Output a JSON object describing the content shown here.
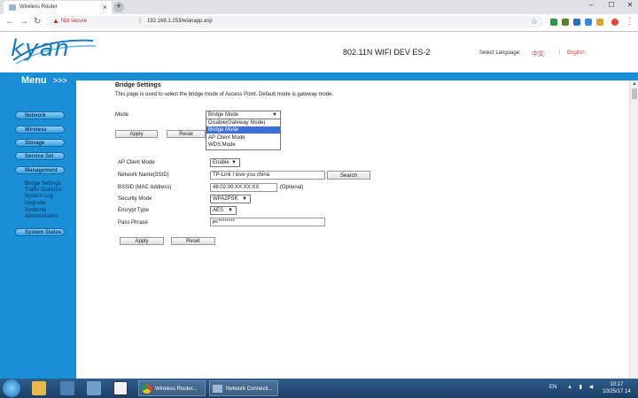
{
  "browser": {
    "tab_title": "Wireless Router",
    "tab_close": "×",
    "new_tab": "+",
    "not_secure": "Not secure",
    "url": "192.168.1.253/wlanapp.asp",
    "window_min": "–",
    "window_max": "☐",
    "window_close": "✕"
  },
  "header": {
    "logo": "kyan",
    "product": "802.11N WIFI DEV   ES-2",
    "select_language": "Select Language:",
    "lang_chinese": "中文",
    "lang_english": "English"
  },
  "menu": {
    "title": "Menu",
    "arrows": ">>>",
    "items": [
      {
        "label": "Network"
      },
      {
        "label": "Wireless"
      },
      {
        "label": "Storage"
      },
      {
        "label": "Service Set"
      },
      {
        "label": "Management"
      }
    ],
    "management_sub": [
      "Bridge Settings",
      "Traffic Statistics",
      "System Log",
      "Upgrade",
      "Systemic Administration"
    ],
    "last": "System Status"
  },
  "page": {
    "title": "Bridge Settings",
    "description": "This page is used to select the bridge mode of Access Point. Default mode is gateway mode.",
    "mode_label": "Mode",
    "mode_value": "Bridge Mode",
    "mode_options": [
      "Disable(Gateway Mode)",
      "Bridge Mode",
      "AP Client Mode",
      "WDS Mode"
    ],
    "apply_top": "Apply",
    "reset_top": "Reset",
    "ap_client_mode_label": "AP Client Mode",
    "ap_client_mode_value": "Enable",
    "ssid_label": "Network Name(SSID)",
    "ssid_value": "TP-Link I love you china",
    "search": "Search",
    "bssid_label": "BSSID (MAC Address)",
    "bssid_value": "48:02:00:XX:XX:XX",
    "optional": "(Optional)",
    "security_mode_label": "Security Mode",
    "security_mode_value": "WPA2PSK",
    "encrypt_type_label": "Encrypt Type",
    "encrypt_type_value": "AES",
    "pass_phrase_label": "Pass Phrase",
    "pass_phrase_value": "pc********",
    "apply_bottom": "Apply",
    "reset_bottom": "Reset"
  },
  "taskbar": {
    "chrome_item": "Wireless Router...",
    "network_item": "Network Connecti...",
    "tray_lang": "EN",
    "time": "10:17",
    "date": "10/25/17 14"
  }
}
